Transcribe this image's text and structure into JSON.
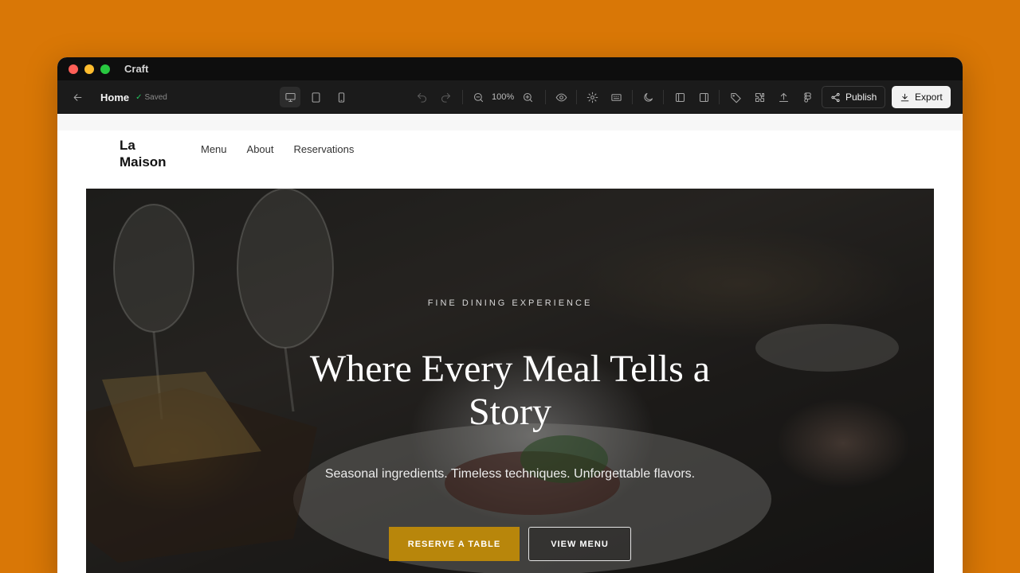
{
  "app": {
    "name": "Craft",
    "traffic_lights": [
      "#FF5F57",
      "#FEBC2E",
      "#28C840"
    ]
  },
  "colors": {
    "background": "#D97706",
    "accent_gold": "#B8860B",
    "saved_green": "#22C55E"
  },
  "toolbar": {
    "page_name": "Home",
    "saved_status": "Saved",
    "zoom": "100%",
    "publish_label": "Publish",
    "export_label": "Export",
    "icons": [
      "back-arrow-icon",
      "desktop-icon",
      "tablet-icon",
      "mobile-icon",
      "undo-icon",
      "redo-icon",
      "zoom-out-icon",
      "zoom-in-icon",
      "eye-icon",
      "gear-icon",
      "keyboard-icon",
      "moon-icon",
      "panel-left-icon",
      "panel-right-icon",
      "tag-icon",
      "puzzle-icon",
      "upload-icon",
      "figma-icon",
      "share-icon",
      "download-icon"
    ]
  },
  "site": {
    "logo": "La Maison",
    "nav": [
      "Menu",
      "About",
      "Reservations"
    ],
    "hero": {
      "eyebrow": "FINE DINING EXPERIENCE",
      "title": "Where Every Meal Tells a Story",
      "subtitle": "Seasonal ingredients. Timeless techniques. Unforgettable flavors.",
      "primary_cta": "RESERVE A TABLE",
      "secondary_cta": "VIEW MENU"
    }
  }
}
